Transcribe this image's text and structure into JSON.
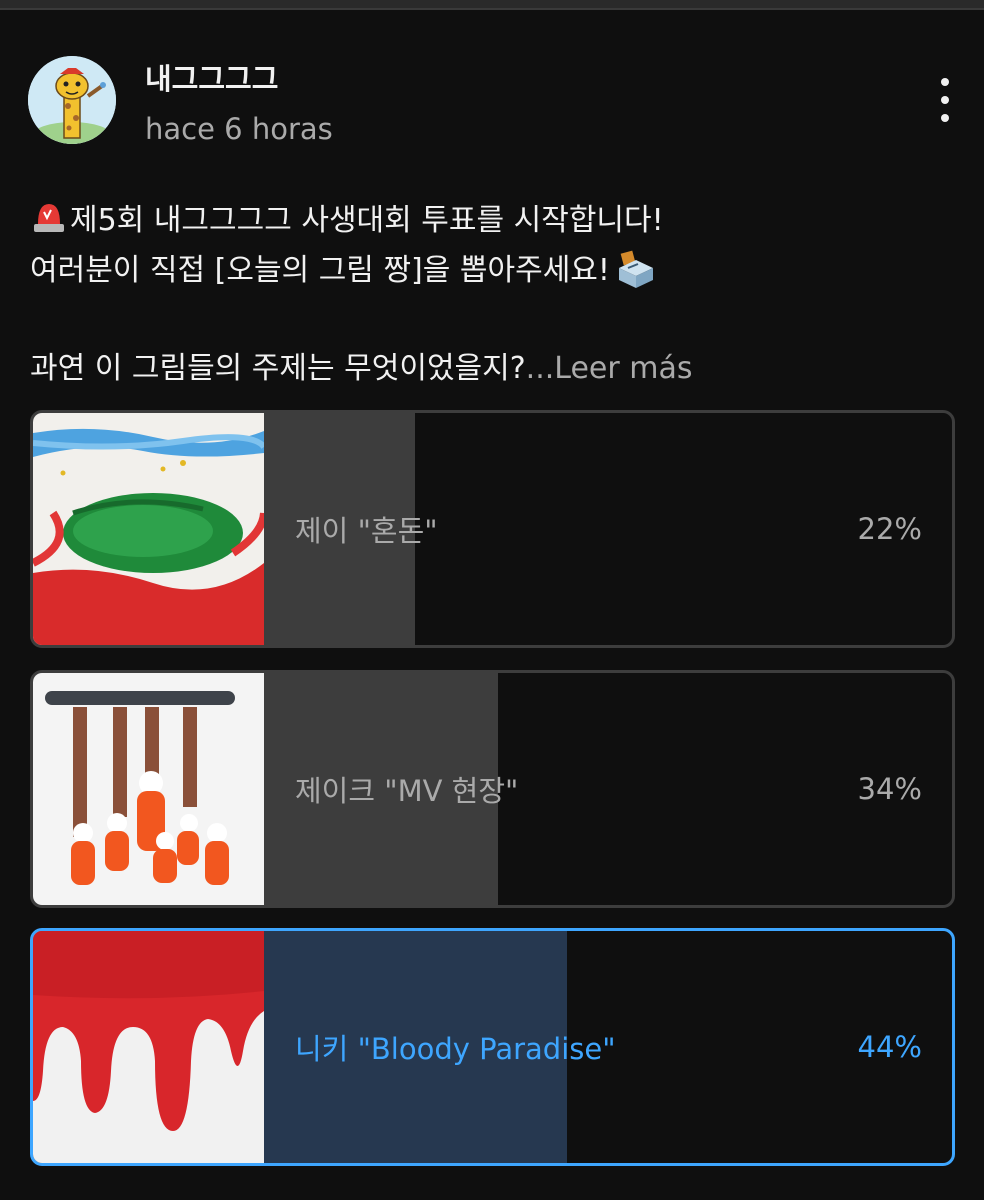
{
  "post": {
    "channel_name": "내그그그그",
    "time_ago": "hace 6 horas",
    "line1": "제5회 내그그그그 사생대회 투표를 시작합니다!",
    "line2": "여러분이 직접 [오늘의 그림 짱]을 뽑아주세요!",
    "line3": "과연 이 그림들의 주제는 무엇이었을지?",
    "read_more": "...Leer más"
  },
  "poll": {
    "options": [
      {
        "label": "제이 \"혼돈\"",
        "percent_text": "22%",
        "percent": 22,
        "selected": false
      },
      {
        "label": "제이크 \"MV 현장\"",
        "percent_text": "34%",
        "percent": 34,
        "selected": false
      },
      {
        "label": "니키 \"Bloody Paradise\"",
        "percent_text": "44%",
        "percent": 44,
        "selected": true
      }
    ]
  },
  "colors": {
    "background": "#0f0f0f",
    "accent": "#3ea6ff",
    "muted_text": "#aaaaaa"
  }
}
